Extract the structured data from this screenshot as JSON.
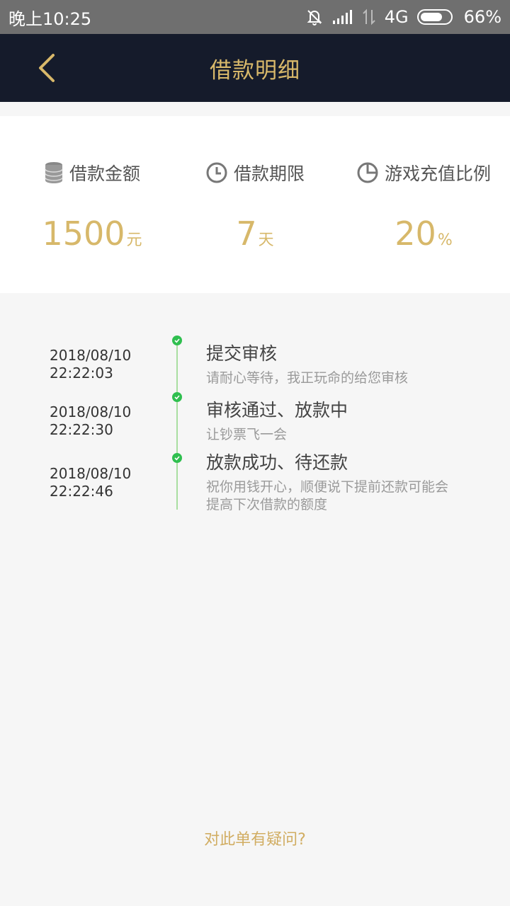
{
  "status_bar": {
    "time": "晚上10:25",
    "network": "4G",
    "battery": "66%"
  },
  "header": {
    "title": "借款明细"
  },
  "summary": {
    "items": [
      {
        "label": "借款金额",
        "value": "1500",
        "unit": "元",
        "icon": "coins-icon"
      },
      {
        "label": "借款期限",
        "value": "7",
        "unit": "天",
        "icon": "clock-icon"
      },
      {
        "label": "游戏充值比例",
        "value": "20",
        "unit": "%",
        "icon": "pie-chart-icon"
      }
    ]
  },
  "timeline": [
    {
      "date": "2018/08/10",
      "time": "22:22:03",
      "title": "提交审核",
      "desc": "请耐心等待，我正玩命的给您审核"
    },
    {
      "date": "2018/08/10",
      "time": "22:22:30",
      "title": "审核通过、放款中",
      "desc": "让钞票飞一会"
    },
    {
      "date": "2018/08/10",
      "time": "22:22:46",
      "title": "放款成功、待还款",
      "desc": "祝你用钱开心，顺便说下提前还款可能会提高下次借款的额度"
    }
  ],
  "footer": {
    "question_link": "对此单有疑问?"
  },
  "colors": {
    "nav_bg": "#151b2b",
    "accent_gold": "#d7b86a",
    "success_green": "#2fbf4f"
  }
}
